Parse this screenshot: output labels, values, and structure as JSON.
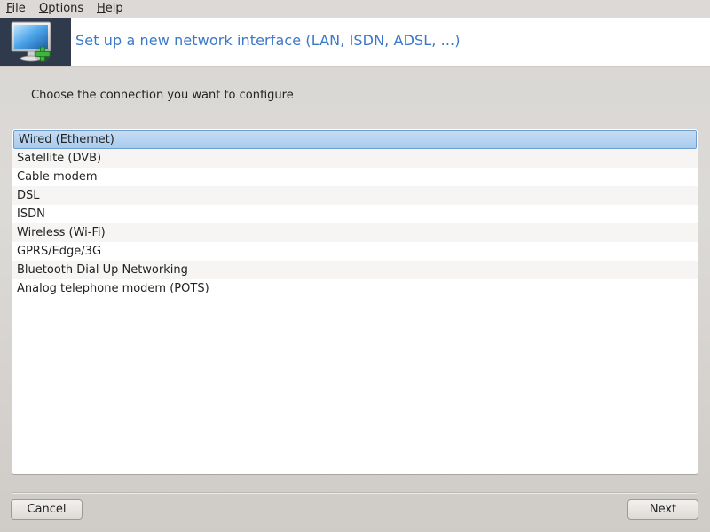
{
  "menubar": {
    "items": [
      {
        "mnemonic": "F",
        "rest": "ile"
      },
      {
        "mnemonic": "O",
        "rest": "ptions"
      },
      {
        "mnemonic": "H",
        "rest": "elp"
      }
    ]
  },
  "banner": {
    "title": "Set up a new network interface (LAN, ISDN, ADSL, ...)",
    "icon": "network-monitor-add-icon"
  },
  "prompt": "Choose the connection you want to configure",
  "connections": {
    "selected_index": 0,
    "items": [
      "Wired (Ethernet)",
      "Satellite (DVB)",
      "Cable modem",
      "DSL",
      "ISDN",
      "Wireless (Wi-Fi)",
      "GPRS/Edge/3G",
      "Bluetooth Dial Up Networking",
      "Analog telephone modem (POTS)"
    ]
  },
  "buttons": {
    "cancel": "Cancel",
    "next": "Next"
  },
  "colors": {
    "title": "#3b78c8",
    "icon_bg": "#2f3b4c",
    "selection": "#a9cbee"
  }
}
